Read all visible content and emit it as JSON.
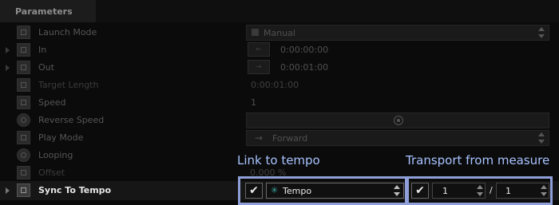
{
  "panel": {
    "title": "Parameters"
  },
  "params": {
    "launch_mode": {
      "label": "Launch Mode",
      "value": "Manual"
    },
    "in": {
      "label": "In",
      "value": "0:00:00:00"
    },
    "out": {
      "label": "Out",
      "value": "0:00:01:00"
    },
    "target_length": {
      "label": "Target Length",
      "value": "0:00:01:00"
    },
    "speed": {
      "label": "Speed",
      "value": "1"
    },
    "reverse_speed": {
      "label": "Reverse Speed"
    },
    "play_mode": {
      "label": "Play Mode",
      "value": "Forward",
      "arrow": "→"
    },
    "looping": {
      "label": "Looping"
    },
    "offset": {
      "label": "Offset",
      "value": "0.000 %"
    },
    "sync_to_tempo": {
      "label": "Sync To Tempo",
      "tempo_value": "Tempo",
      "measure_numerator": "1",
      "measure_separator": "/",
      "measure_denominator": "1"
    }
  },
  "annotations": {
    "link_to_tempo": "Link to tempo",
    "transport_from_measure": "Transport from measure"
  },
  "colors": {
    "background": "#0b0b0b",
    "highlight_border": "#8f9fd8",
    "annotation_text": "#a8c3ff"
  },
  "icons": {
    "checkmark": "✔",
    "tempo_asterisk": "✳"
  }
}
